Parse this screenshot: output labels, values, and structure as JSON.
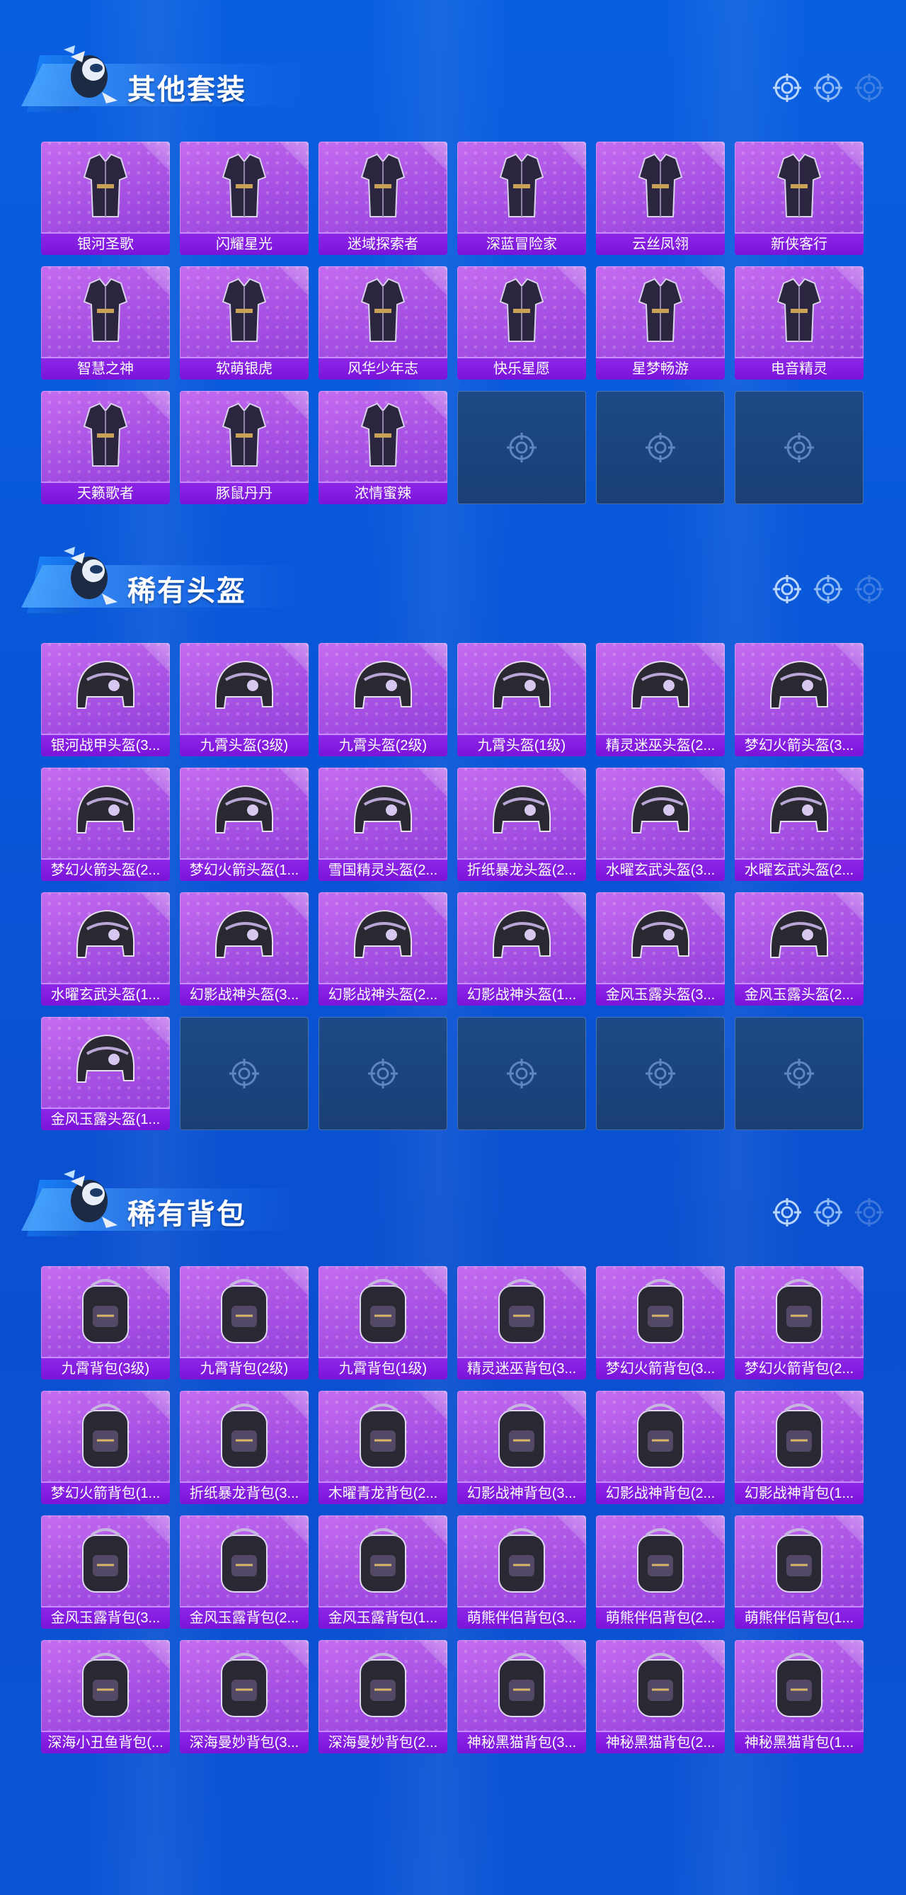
{
  "sections": [
    {
      "id": "suits",
      "title": "其他套装",
      "items": [
        {
          "label": "银河圣歌",
          "icon": "outfit-icon"
        },
        {
          "label": "闪耀星光",
          "icon": "outfit-icon"
        },
        {
          "label": "迷域探索者",
          "icon": "outfit-icon"
        },
        {
          "label": "深蓝冒险家",
          "icon": "outfit-icon"
        },
        {
          "label": "云丝凤翎",
          "icon": "outfit-icon"
        },
        {
          "label": "新侠客行",
          "icon": "outfit-icon"
        },
        {
          "label": "智慧之神",
          "icon": "outfit-icon"
        },
        {
          "label": "软萌银虎",
          "icon": "outfit-icon"
        },
        {
          "label": "风华少年志",
          "icon": "outfit-icon"
        },
        {
          "label": "快乐星愿",
          "icon": "outfit-icon"
        },
        {
          "label": "星梦畅游",
          "icon": "outfit-icon"
        },
        {
          "label": "电音精灵",
          "icon": "outfit-icon"
        },
        {
          "label": "天籁歌者",
          "icon": "outfit-icon"
        },
        {
          "label": "豚鼠丹丹",
          "icon": "outfit-icon"
        },
        {
          "label": "浓情蜜辣",
          "icon": "outfit-icon"
        }
      ],
      "empty_slots": 3
    },
    {
      "id": "helmets",
      "title": "稀有头盔",
      "items": [
        {
          "label": "银河战甲头盔(3...",
          "icon": "helmet-icon"
        },
        {
          "label": "九霄头盔(3级)",
          "icon": "helmet-icon"
        },
        {
          "label": "九霄头盔(2级)",
          "icon": "helmet-icon"
        },
        {
          "label": "九霄头盔(1级)",
          "icon": "helmet-icon"
        },
        {
          "label": "精灵迷巫头盔(2...",
          "icon": "helmet-icon"
        },
        {
          "label": "梦幻火箭头盔(3...",
          "icon": "helmet-icon"
        },
        {
          "label": "梦幻火箭头盔(2...",
          "icon": "helmet-icon"
        },
        {
          "label": "梦幻火箭头盔(1...",
          "icon": "helmet-icon"
        },
        {
          "label": "雪国精灵头盔(2...",
          "icon": "helmet-icon"
        },
        {
          "label": "折纸暴龙头盔(2...",
          "icon": "helmet-icon"
        },
        {
          "label": "水曜玄武头盔(3...",
          "icon": "helmet-icon"
        },
        {
          "label": "水曜玄武头盔(2...",
          "icon": "helmet-icon"
        },
        {
          "label": "水曜玄武头盔(1...",
          "icon": "helmet-icon"
        },
        {
          "label": "幻影战神头盔(3...",
          "icon": "helmet-icon"
        },
        {
          "label": "幻影战神头盔(2...",
          "icon": "helmet-icon"
        },
        {
          "label": "幻影战神头盔(1...",
          "icon": "helmet-icon"
        },
        {
          "label": "金风玉露头盔(3...",
          "icon": "helmet-icon"
        },
        {
          "label": "金风玉露头盔(2...",
          "icon": "helmet-icon"
        },
        {
          "label": "金风玉露头盔(1...",
          "icon": "helmet-icon"
        }
      ],
      "empty_slots": 5
    },
    {
      "id": "backpacks",
      "title": "稀有背包",
      "items": [
        {
          "label": "九霄背包(3级)",
          "icon": "backpack-icon"
        },
        {
          "label": "九霄背包(2级)",
          "icon": "backpack-icon"
        },
        {
          "label": "九霄背包(1级)",
          "icon": "backpack-icon"
        },
        {
          "label": "精灵迷巫背包(3...",
          "icon": "backpack-icon"
        },
        {
          "label": "梦幻火箭背包(3...",
          "icon": "backpack-icon"
        },
        {
          "label": "梦幻火箭背包(2...",
          "icon": "backpack-icon"
        },
        {
          "label": "梦幻火箭背包(1...",
          "icon": "backpack-icon"
        },
        {
          "label": "折纸暴龙背包(3...",
          "icon": "backpack-icon"
        },
        {
          "label": "木曜青龙背包(2...",
          "icon": "backpack-icon"
        },
        {
          "label": "幻影战神背包(3...",
          "icon": "backpack-icon"
        },
        {
          "label": "幻影战神背包(2...",
          "icon": "backpack-icon"
        },
        {
          "label": "幻影战神背包(1...",
          "icon": "backpack-icon"
        },
        {
          "label": "金风玉露背包(3...",
          "icon": "backpack-icon"
        },
        {
          "label": "金风玉露背包(2...",
          "icon": "backpack-icon"
        },
        {
          "label": "金风玉露背包(1...",
          "icon": "backpack-icon"
        },
        {
          "label": "萌熊伴侣背包(3...",
          "icon": "backpack-icon"
        },
        {
          "label": "萌熊伴侣背包(2...",
          "icon": "backpack-icon"
        },
        {
          "label": "萌熊伴侣背包(1...",
          "icon": "backpack-icon"
        },
        {
          "label": "深海小丑鱼背包(...",
          "icon": "backpack-icon"
        },
        {
          "label": "深海曼妙背包(3...",
          "icon": "backpack-icon"
        },
        {
          "label": "深海曼妙背包(2...",
          "icon": "backpack-icon"
        },
        {
          "label": "神秘黑猫背包(3...",
          "icon": "backpack-icon"
        },
        {
          "label": "神秘黑猫背包(2...",
          "icon": "backpack-icon"
        },
        {
          "label": "神秘黑猫背包(1...",
          "icon": "backpack-icon"
        }
      ],
      "empty_slots": 0
    }
  ],
  "colors": {
    "background": "#0a58dc",
    "card_purple": "#a44ee2",
    "label_bar": "#8420e0",
    "empty_slot": "#1d4a86"
  }
}
